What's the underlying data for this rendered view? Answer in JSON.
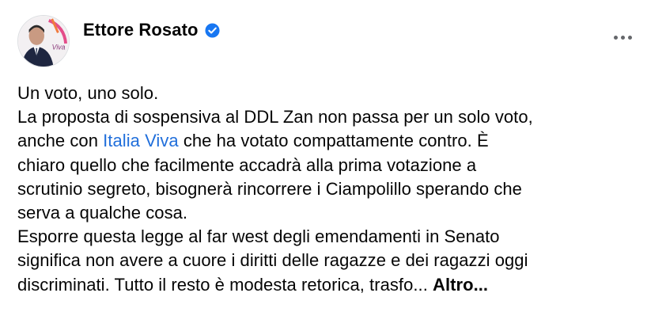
{
  "post": {
    "author": {
      "name": "Ettore Rosato",
      "verified_icon": "verified-badge-icon",
      "avatar_icon": "profile-photo",
      "avatar_badge_text": "Viva"
    },
    "more_icon": "more-options-icon",
    "lines": [
      "Un voto, uno solo.",
      "La proposta di sospensiva al DDL Zan non passa per un solo voto,",
      {
        "before": "anche con ",
        "mention": "Italia Viva",
        "after": " che ha votato compattamente contro. È"
      },
      "chiaro quello che facilmente accadrà alla prima votazione a",
      "scrutinio segreto, bisognerà rincorrere i Ciampolillo sperando che",
      "serva a qualche cosa.",
      "Esporre questa legge al far west degli emendamenti in Senato",
      "significa non avere a cuore i diritti delle ragazze e dei ragazzi oggi",
      {
        "before": "discriminati. Tutto il resto è modesta retorica, trasfo... ",
        "see_more": "Altro..."
      }
    ],
    "colors": {
      "text": "#050505",
      "link": "#216fdb",
      "verified": "#1877f2",
      "secondary": "#65676b"
    }
  }
}
